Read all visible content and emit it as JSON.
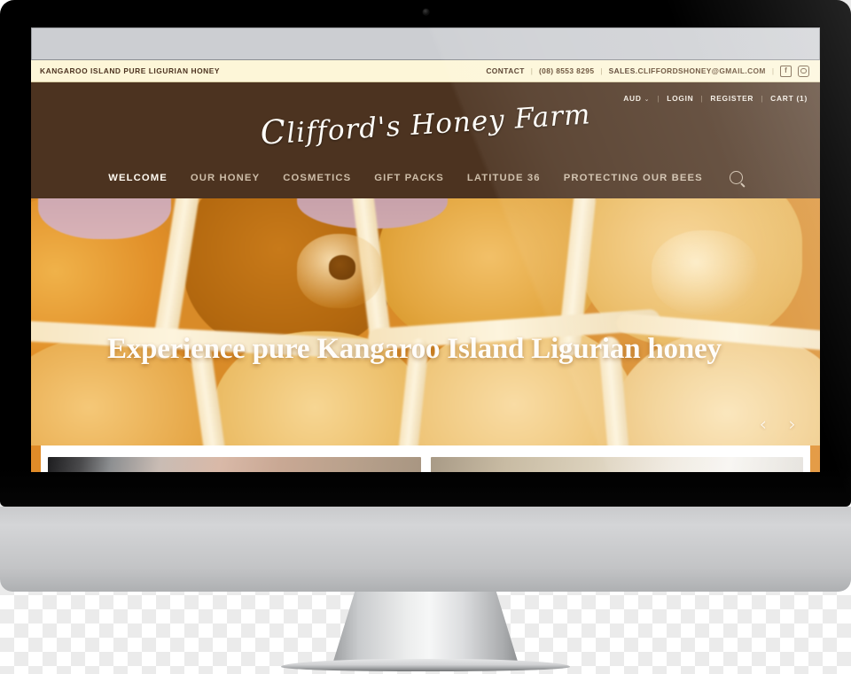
{
  "device": {
    "type": "imac-desktop-monitor",
    "webcam": "webcam-dot"
  },
  "browser": {
    "chrome_label": ""
  },
  "site": {
    "topbar": {
      "tagline": "KANGAROO ISLAND PURE LIGURIAN HONEY",
      "contact_label": "CONTACT",
      "phone": "(08) 8553 8295",
      "sales_label": "SALES",
      "email": ".CLIFFORDSHONEY@GMAIL.COM",
      "separator": "|",
      "social": [
        {
          "name": "facebook-icon",
          "glyph": "f"
        },
        {
          "name": "instagram-icon",
          "glyph": ""
        }
      ],
      "colors": {
        "background": "#fdf6d8",
        "text": "#4c3320"
      }
    },
    "header": {
      "logo_cap": "C",
      "logo_rest": "lifford's Honey Farm",
      "background": "#4c3320",
      "utility": {
        "currency": "AUD",
        "currency_chevron": "⌄",
        "login": "LOGIN",
        "register": "REGISTER",
        "cart": "CART (1)",
        "separator": "|"
      },
      "nav": [
        {
          "label": "WELCOME",
          "active": true
        },
        {
          "label": "OUR HONEY",
          "active": false
        },
        {
          "label": "COSMETICS",
          "active": false
        },
        {
          "label": "GIFT PACKS",
          "active": false
        },
        {
          "label": "LATITUDE 36",
          "active": false
        },
        {
          "label": "PROTECTING OUR BEES",
          "active": false
        }
      ],
      "search_icon": "search-icon"
    },
    "hero": {
      "headline": "Experience pure Kangaroo Island Ligurian honey",
      "image_subject": "macro photo of honeycomb cells filled with golden honey",
      "prev_arrow": "‹",
      "next_arrow": "›",
      "accent_color": "#e08b28"
    },
    "content_strip": {
      "cards": [
        {
          "name": "content-card-left"
        },
        {
          "name": "content-card-right"
        }
      ]
    }
  }
}
